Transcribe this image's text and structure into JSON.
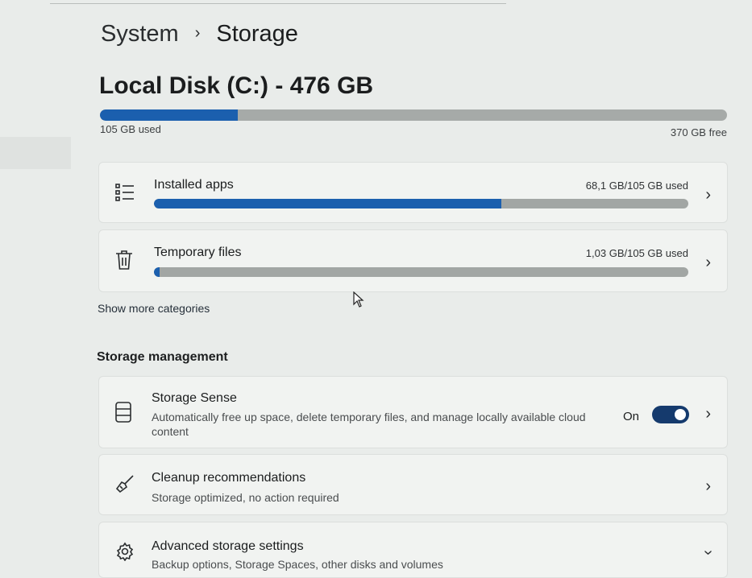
{
  "breadcrumb": {
    "root": "System",
    "separator": "›",
    "current": "Storage"
  },
  "disk": {
    "title": "Local Disk (C:) - 476 GB",
    "used_label": "105 GB used",
    "free_label": "370 GB free",
    "used_fraction": 0.22
  },
  "categories": [
    {
      "label": "Installed apps",
      "usage": "68,1 GB/105 GB used",
      "fraction": 0.65,
      "icon": "list-icon"
    },
    {
      "label": "Temporary files",
      "usage": "1,03 GB/105 GB used",
      "fraction": 0.01,
      "icon": "trash-icon"
    }
  ],
  "show_more": "Show more categories",
  "storage_management": {
    "heading": "Storage management",
    "items": [
      {
        "title": "Storage Sense",
        "description": "Automatically free up space, delete temporary files, and manage locally available cloud content",
        "toggle_label": "On",
        "toggle_on": true,
        "icon": "storage-sense-icon"
      },
      {
        "title": "Cleanup recommendations",
        "description": "Storage optimized, no action required",
        "icon": "broom-icon"
      },
      {
        "title": "Advanced storage settings",
        "description": "Backup options, Storage Spaces, other disks and volumes",
        "icon": "gear-icon"
      }
    ]
  },
  "colors": {
    "accent": "#1b5fae",
    "toggle": "#153a6d",
    "bar_track": "#a6aaa8"
  }
}
